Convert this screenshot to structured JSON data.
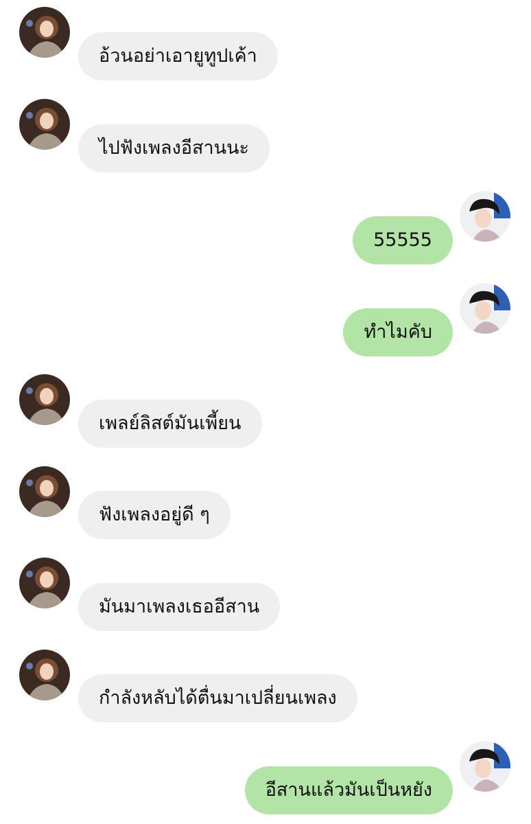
{
  "colors": {
    "incoming_bubble": "#efefef",
    "outgoing_bubble": "#b2e4a6",
    "text": "#111111",
    "background": "#ffffff"
  },
  "messages": [
    {
      "side": "in",
      "text": "อ้วนอย่าเอายูทูปเค้า"
    },
    {
      "side": "in",
      "text": "ไปฟังเพลงอีสานนะ"
    },
    {
      "side": "out",
      "text": "55555"
    },
    {
      "side": "out",
      "text": "ทำไมคับ"
    },
    {
      "side": "in",
      "text": "เพลย์ลิสต์มันเพี้ยน"
    },
    {
      "side": "in",
      "text": "ฟังเพลงอยู่ดี ๆ"
    },
    {
      "side": "in",
      "text": "มันมาเพลงเธออีสาน"
    },
    {
      "side": "in",
      "text": "กำลังหลับได้ตื่นมาเปลี่ยนเพลง"
    },
    {
      "side": "out",
      "text": "อีสานแล้วมันเป็นหยัง"
    }
  ]
}
